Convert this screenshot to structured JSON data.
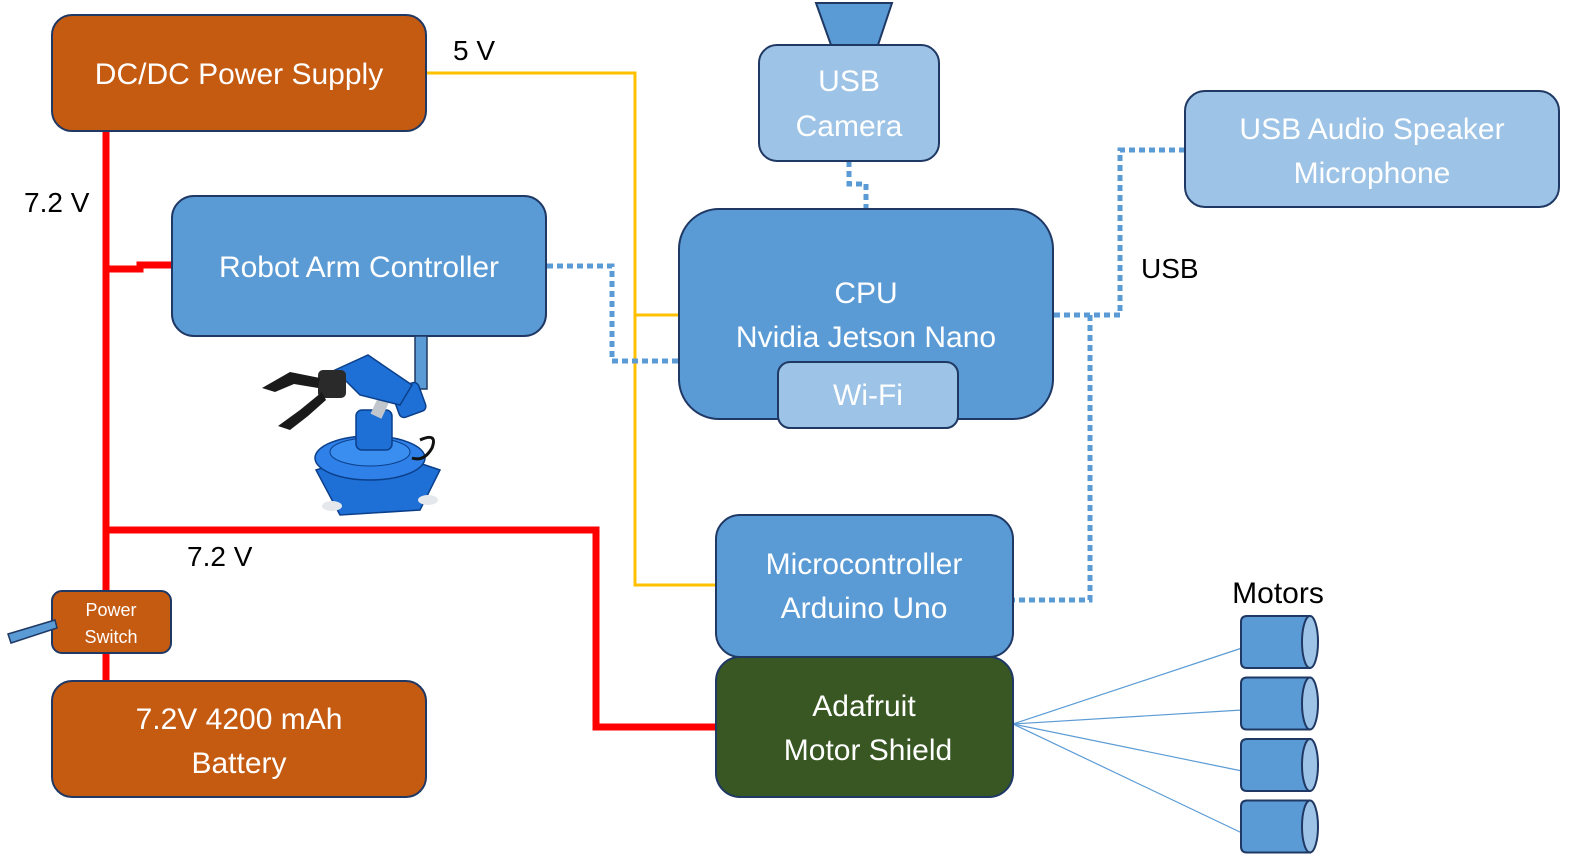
{
  "colors": {
    "power_box": "#c55a11",
    "cpu_box": "#5b9bd5",
    "light_box": "#9dc3e6",
    "shield_box": "#385723",
    "border": "#1f3864",
    "power_line_72": "#ff0000",
    "power_line_5": "#ffc000",
    "usb_line": "#5b9bd5",
    "motor_wire": "#5b9bd5"
  },
  "nodes": {
    "dcdc": {
      "lines": [
        "DC/DC Power Supply"
      ]
    },
    "robot_arm_controller": {
      "lines": [
        "Robot Arm Controller"
      ]
    },
    "usb_camera": {
      "lines": [
        "USB",
        "Camera"
      ]
    },
    "usb_audio": {
      "lines": [
        "USB Audio Speaker",
        "Microphone"
      ]
    },
    "cpu": {
      "lines": [
        "CPU",
        "Nvidia Jetson Nano"
      ]
    },
    "wifi": {
      "lines": [
        "Wi-Fi"
      ]
    },
    "microcontroller": {
      "lines": [
        "Microcontroller",
        "Arduino Uno"
      ]
    },
    "motor_shield": {
      "lines": [
        "Adafruit",
        "Motor Shield"
      ]
    },
    "power_switch": {
      "lines": [
        "Power",
        "Switch"
      ]
    },
    "battery": {
      "lines": [
        "7.2V 4200 mAh",
        "Battery"
      ]
    }
  },
  "labels": {
    "five_volt": "5 V",
    "seven_two_top": "7.2 V",
    "seven_two_mid": "7.2 V",
    "usb": "USB",
    "motors": "Motors"
  },
  "motors": {
    "count": 4
  },
  "icons": {
    "camera_lens": "camera-lens-icon",
    "robot_arm": "robot-arm-image",
    "switch_lever": "switch-lever-icon",
    "motor": "motor-cylinder-icon"
  }
}
